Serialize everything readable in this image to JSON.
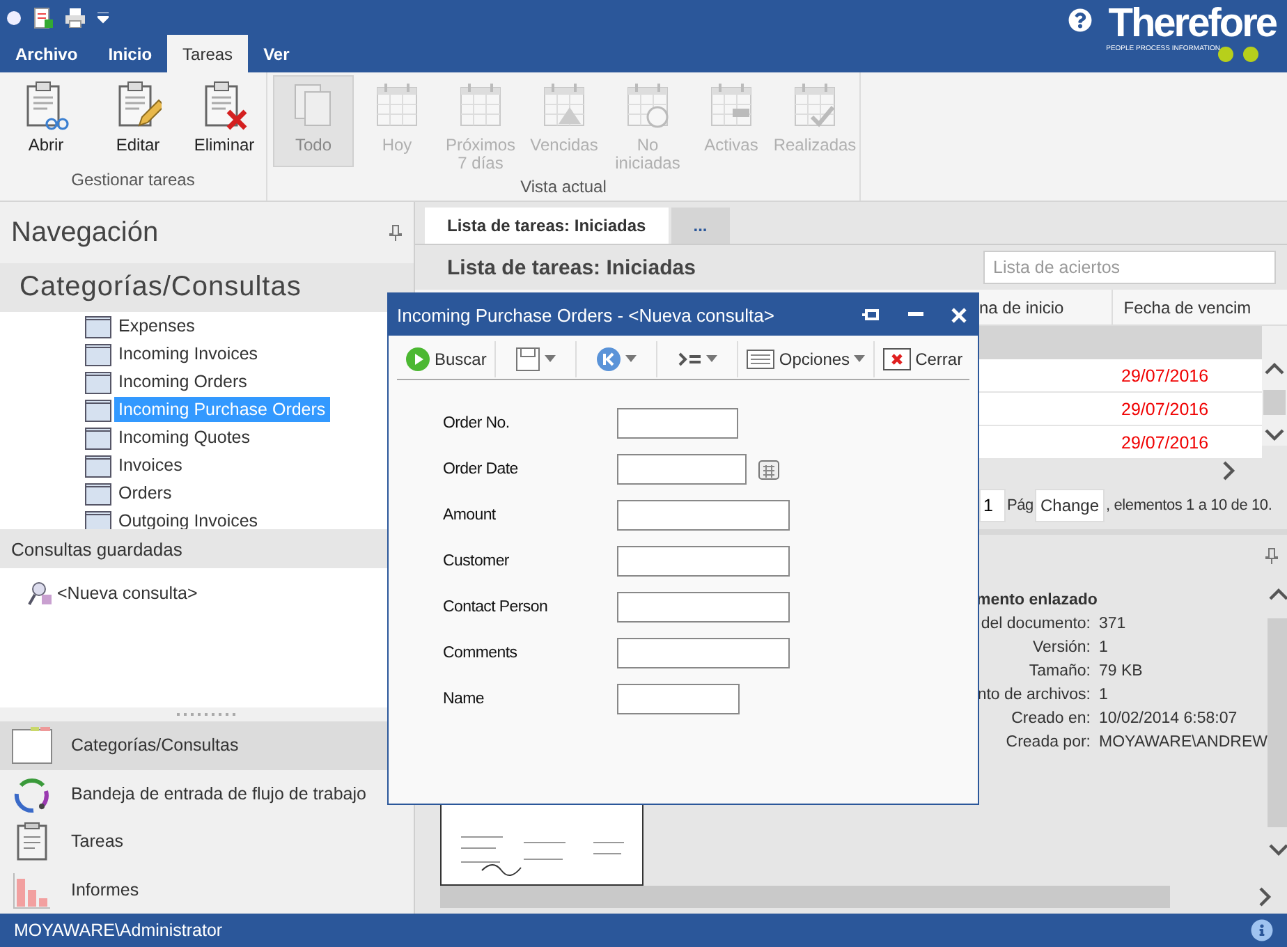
{
  "logo": {
    "name": "Therefore",
    "tagline": "PEOPLE PROCESS INFORMATION"
  },
  "ribbon_tabs": [
    {
      "label": "Archivo",
      "selected": false
    },
    {
      "label": "Inicio",
      "selected": false
    },
    {
      "label": "Tareas",
      "selected": true
    },
    {
      "label": "Ver",
      "selected": false
    }
  ],
  "ribbon_groups": [
    {
      "title": "Gestionar tareas",
      "buttons": [
        {
          "label": "Abrir",
          "disabled": false,
          "selected": false
        },
        {
          "label": "Editar",
          "disabled": false,
          "selected": false
        },
        {
          "label": "Eliminar",
          "disabled": false,
          "selected": false
        }
      ]
    },
    {
      "title": "Vista actual",
      "buttons": [
        {
          "label": "Todo",
          "disabled": true,
          "selected": true
        },
        {
          "label": "Hoy",
          "disabled": true,
          "selected": false
        },
        {
          "label": "Próximos\n7 días",
          "disabled": true,
          "selected": false
        },
        {
          "label": "Vencidas",
          "disabled": true,
          "selected": false
        },
        {
          "label": "No\niniciadas",
          "disabled": true,
          "selected": false
        },
        {
          "label": "Activas",
          "disabled": true,
          "selected": false
        },
        {
          "label": "Realizadas",
          "disabled": true,
          "selected": false
        }
      ]
    }
  ],
  "navigation": {
    "title": "Navegación",
    "section_title": "Categorías/Consultas",
    "tree": [
      {
        "label": "Expenses",
        "selected": false
      },
      {
        "label": "Incoming Invoices",
        "selected": false
      },
      {
        "label": "Incoming Orders",
        "selected": false
      },
      {
        "label": "Incoming Purchase Orders",
        "selected": true
      },
      {
        "label": "Incoming Quotes",
        "selected": false
      },
      {
        "label": "Invoices",
        "selected": false
      },
      {
        "label": "Orders",
        "selected": false
      },
      {
        "label": "Outgoing Invoices",
        "selected": false
      }
    ],
    "saved_title": "Consultas guardadas",
    "saved_queries": [
      {
        "label": "<Nueva consulta>"
      }
    ],
    "nav_buttons": [
      {
        "label": "Categorías/Consultas",
        "selected": true
      },
      {
        "label": "Bandeja de entrada de flujo de trabajo",
        "selected": false
      },
      {
        "label": "Tareas",
        "selected": false
      },
      {
        "label": "Informes",
        "selected": false
      }
    ]
  },
  "document_tabs": [
    {
      "label": "Lista de tareas: Iniciadas",
      "selected": true
    },
    {
      "label": "...",
      "selected": false
    }
  ],
  "task_list": {
    "title": "Lista de tareas: Iniciadas",
    "search": {
      "placeholder": "Lista de aciertos"
    },
    "columns": [
      "na de inicio",
      "Fecha de vencim"
    ],
    "rows": [
      {
        "due": "29/07/2016",
        "overdue": true
      },
      {
        "due": "29/07/2016",
        "overdue": true
      },
      {
        "due": "29/07/2016",
        "overdue": true
      }
    ],
    "pager": {
      "page_size": "1",
      "page_label": "Pág",
      "button": "Change",
      "summary": ", elementos 1 a 10 de 10."
    }
  },
  "preview": {
    "heading": "mento enlazado",
    "properties": [
      {
        "label": "del documento:",
        "value": "371"
      },
      {
        "label": "Versión:",
        "value": "1"
      },
      {
        "label": "Tamaño:",
        "value": "79 KB"
      },
      {
        "label": "nto de archivos:",
        "value": "1"
      },
      {
        "label": "Creado en:",
        "value": "10/02/2014 6:58:07"
      },
      {
        "label": "Creada por:",
        "value": "MOYAWARE\\ANDREW"
      }
    ]
  },
  "dialog": {
    "title": "Incoming Purchase Orders - <Nueva consulta>",
    "toolbar": [
      {
        "kind": "button",
        "label": "Buscar"
      },
      {
        "kind": "menu"
      },
      {
        "kind": "menu"
      },
      {
        "kind": "menu"
      },
      {
        "kind": "button",
        "label": "Opciones",
        "caret": true
      },
      {
        "kind": "button",
        "label": "Cerrar"
      }
    ],
    "fields": [
      {
        "label": "Order No.",
        "kind": "text"
      },
      {
        "label": "Order Date",
        "kind": "date"
      },
      {
        "label": "Amount",
        "kind": "text"
      },
      {
        "label": "Customer",
        "kind": "text"
      },
      {
        "label": "Contact Person",
        "kind": "text"
      },
      {
        "label": "Comments",
        "kind": "text"
      },
      {
        "label": "Name",
        "kind": "text"
      }
    ]
  },
  "status_bar": {
    "user": "MOYAWARE\\Administrator"
  }
}
